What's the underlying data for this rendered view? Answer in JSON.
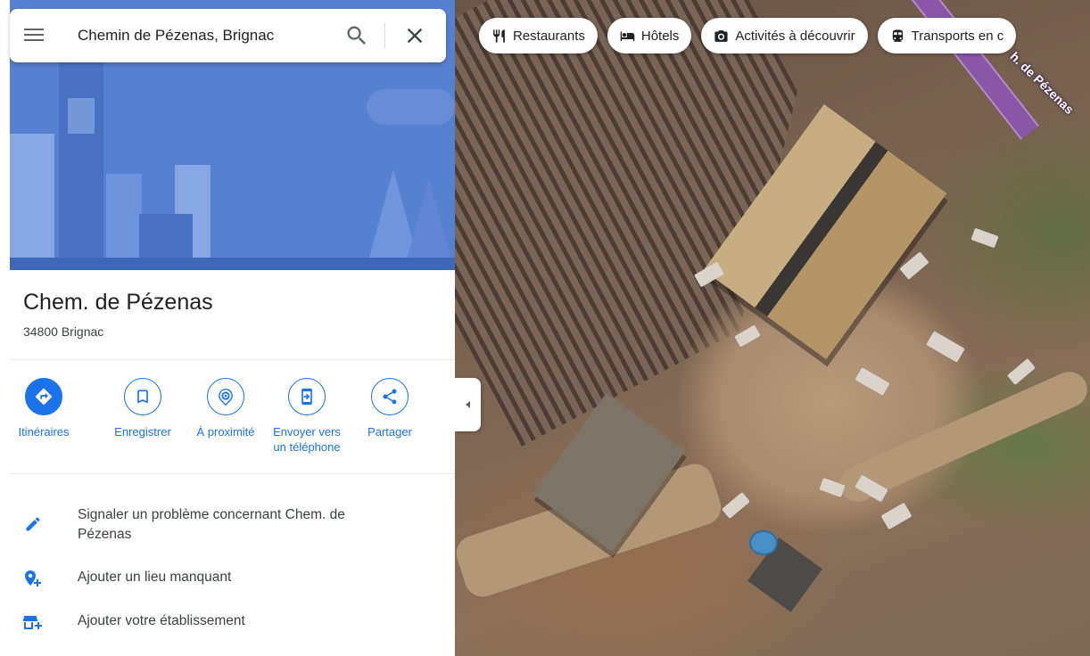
{
  "search": {
    "value": "Chemin de Pézenas, Brignac"
  },
  "place": {
    "title": "Chem. de Pézenas",
    "subtitle": "34800 Brignac"
  },
  "actions": [
    {
      "label": "Itinéraires",
      "icon": "directions-icon"
    },
    {
      "label": "Enregistrer",
      "icon": "bookmark-icon"
    },
    {
      "label": "À proximité",
      "icon": "nearby-icon"
    },
    {
      "label": "Envoyer vers un téléphone",
      "icon": "send-to-phone-icon"
    },
    {
      "label": "Partager",
      "icon": "share-icon"
    }
  ],
  "links": [
    {
      "label": "Signaler un problème concernant Chem. de Pézenas",
      "icon": "pencil-icon"
    },
    {
      "label": "Ajouter un lieu manquant",
      "icon": "add-place-icon"
    },
    {
      "label": "Ajouter votre établissement",
      "icon": "add-business-icon"
    }
  ],
  "chips": [
    {
      "label": "Restaurants",
      "icon": "restaurant-icon"
    },
    {
      "label": "Hôtels",
      "icon": "hotel-icon"
    },
    {
      "label": "Activités à découvrir",
      "icon": "camera-icon"
    },
    {
      "label": "Transports en c",
      "icon": "transit-icon"
    }
  ],
  "map": {
    "road_label": "h. de Pézenas"
  },
  "colors": {
    "accent": "#1a73e8",
    "hero": "#5680d0",
    "road": "#8a56a8"
  }
}
